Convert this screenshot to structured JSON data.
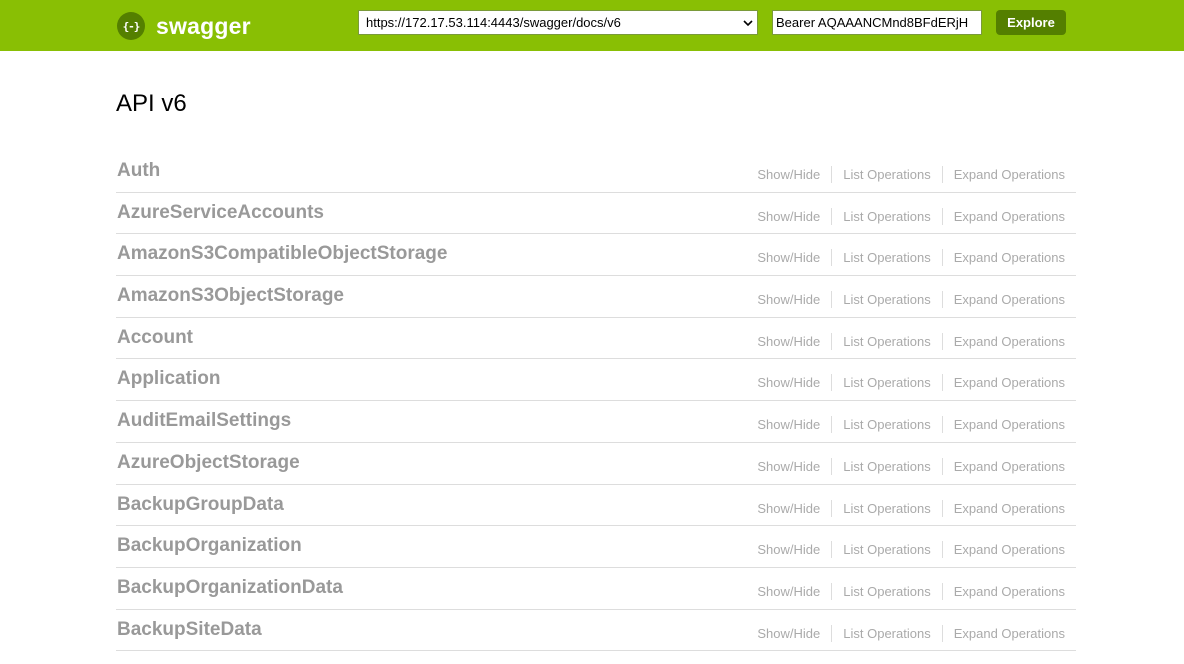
{
  "header": {
    "logo_icon": "{-}",
    "logo_text": "swagger",
    "url_select_value": "https://172.17.53.114:4443/swagger/docs/v6",
    "token_value": "Bearer AQAAANCMnd8BFdERjH",
    "explore_label": "Explore",
    "colors": {
      "bar": "#89bf04",
      "button": "#547f00"
    }
  },
  "page": {
    "title": "API v6"
  },
  "operations": {
    "show_hide": "Show/Hide",
    "list": "List Operations",
    "expand": "Expand Operations"
  },
  "resources": [
    "Auth",
    "AzureServiceAccounts",
    "AmazonS3CompatibleObjectStorage",
    "AmazonS3ObjectStorage",
    "Account",
    "Application",
    "AuditEmailSettings",
    "AzureObjectStorage",
    "BackupGroupData",
    "BackupOrganization",
    "BackupOrganizationData",
    "BackupSiteData"
  ]
}
